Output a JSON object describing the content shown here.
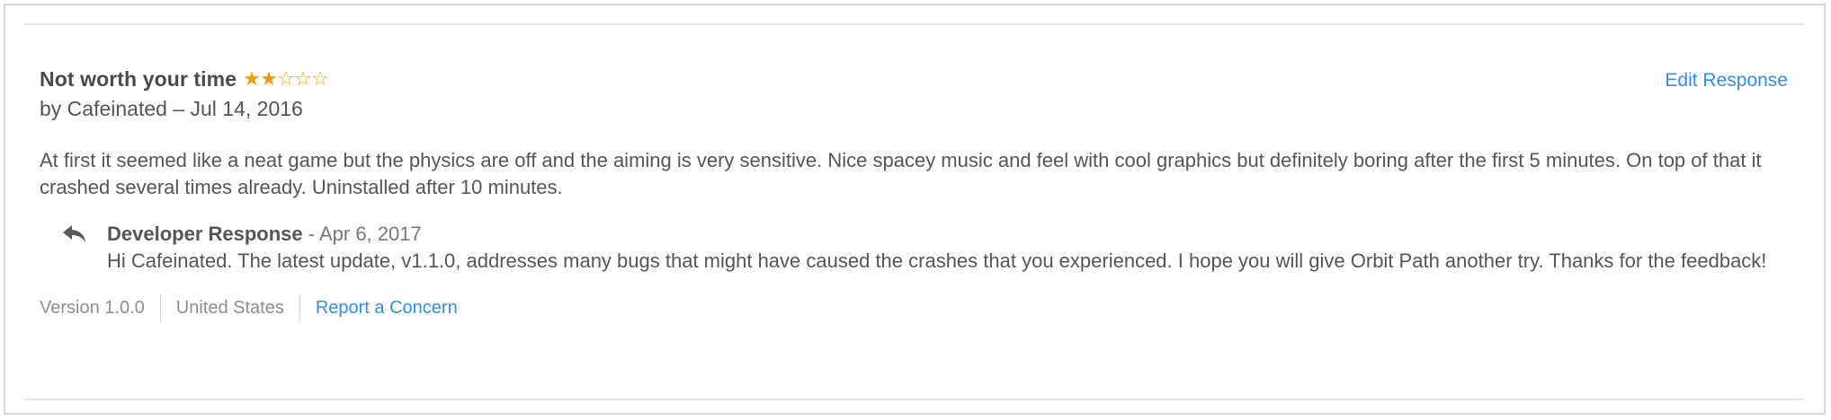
{
  "review": {
    "title": "Not worth your time",
    "rating": 2,
    "max_rating": 5,
    "star_filled": "★",
    "star_empty": "☆",
    "byline": "by Cafeinated – Jul 14, 2016",
    "body": "At first it seemed like a neat game but the physics are off and the aiming is very sensitive. Nice spacey music and feel with cool graphics but definitely boring after the first 5 minutes. On top of that it crashed several times already. Uninstalled after 10 minutes.",
    "edit_label": "Edit Response"
  },
  "developer_response": {
    "icon": "reply-icon",
    "title": "Developer Response",
    "date": " - Apr 6, 2017",
    "text": "Hi Cafeinated. The latest update, v1.1.0, addresses many bugs that might have caused the crashes that you experienced. I hope you will give Orbit Path another try. Thanks for the feedback!"
  },
  "meta": {
    "version": "Version 1.0.0",
    "region": "United States",
    "report_label": "Report a Concern"
  },
  "colors": {
    "accent": "#2f8fe8",
    "star": "#f59b0b",
    "text": "#555555",
    "muted": "#8e8e8e"
  }
}
